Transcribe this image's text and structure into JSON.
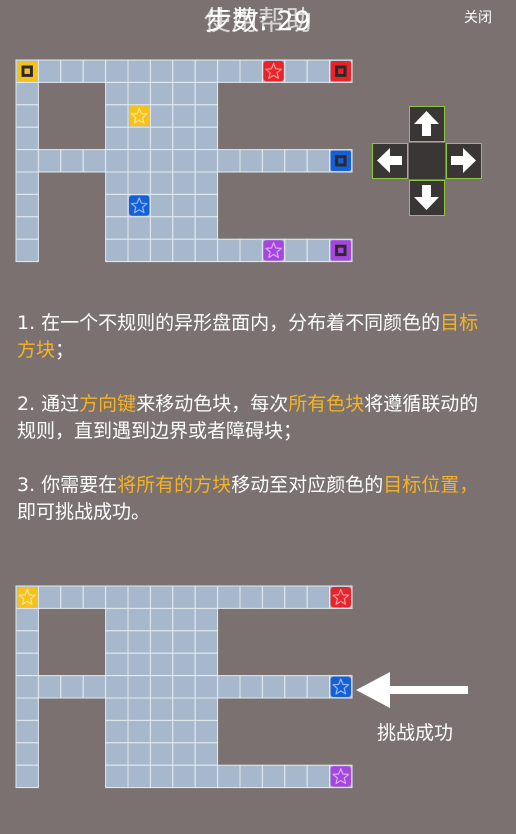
{
  "header": {
    "title_layers": [
      "步数: 29",
      "使用帮助"
    ],
    "close_label": "关闭"
  },
  "colors": {
    "cell_fill": "#a8b8cc",
    "cell_stroke": "#e3eaf1",
    "yellow": "#f5c21b",
    "red": "#e8242a",
    "blue": "#1560d8",
    "purple": "#a546e0",
    "highlight": "#f5b324",
    "dpad_border": "#8dc63f"
  },
  "board": {
    "cols": 15,
    "rows": 9,
    "rows_mask": [
      "XXXXXXXXXXXXXXX",
      "X...XXXXX......",
      "X...XXXXX......",
      "X...XXXXX......",
      "XXXXXXXXXXXXXXX",
      "X...XXXXX......",
      "X...XXXXX......",
      "X...XXXXX......",
      "X...XXXXXXXXXXX"
    ],
    "top_targets": [
      {
        "color": "yellow",
        "row": 0,
        "col": 0
      },
      {
        "color": "red",
        "row": 0,
        "col": 14
      },
      {
        "color": "blue",
        "row": 4,
        "col": 14
      },
      {
        "color": "purple",
        "row": 8,
        "col": 14
      }
    ],
    "top_blocks": [
      {
        "color": "red",
        "row": 0,
        "col": 11
      },
      {
        "color": "yellow",
        "row": 2,
        "col": 5
      },
      {
        "color": "blue",
        "row": 6,
        "col": 5
      },
      {
        "color": "purple",
        "row": 8,
        "col": 11
      }
    ],
    "bottom_blocks": [
      {
        "color": "yellow",
        "row": 0,
        "col": 0
      },
      {
        "color": "red",
        "row": 0,
        "col": 14
      },
      {
        "color": "blue",
        "row": 4,
        "col": 14
      },
      {
        "color": "purple",
        "row": 8,
        "col": 14
      }
    ]
  },
  "dpad": {
    "up": "arrow-up-icon",
    "left": "arrow-left-icon",
    "right": "arrow-right-icon",
    "down": "arrow-down-icon"
  },
  "instructions": {
    "p1": {
      "a": "1. 在一个不规则的异形盘面内，分布着不同颜色的",
      "b": "目标方块",
      "c": "；"
    },
    "p2": {
      "a": "2. 通过",
      "b": "方向键",
      "c": "来移动色块，每次",
      "d": "所有色块",
      "e": "将遵循联动的规则，直到遇到边界或者障碍块；"
    },
    "p3": {
      "a": "3. 你需要在",
      "b": "将所有的方块",
      "c": "移动至对应颜色的",
      "d": "目标位置，",
      "e": "即可挑战成功。"
    }
  },
  "success_label": "挑战成功"
}
